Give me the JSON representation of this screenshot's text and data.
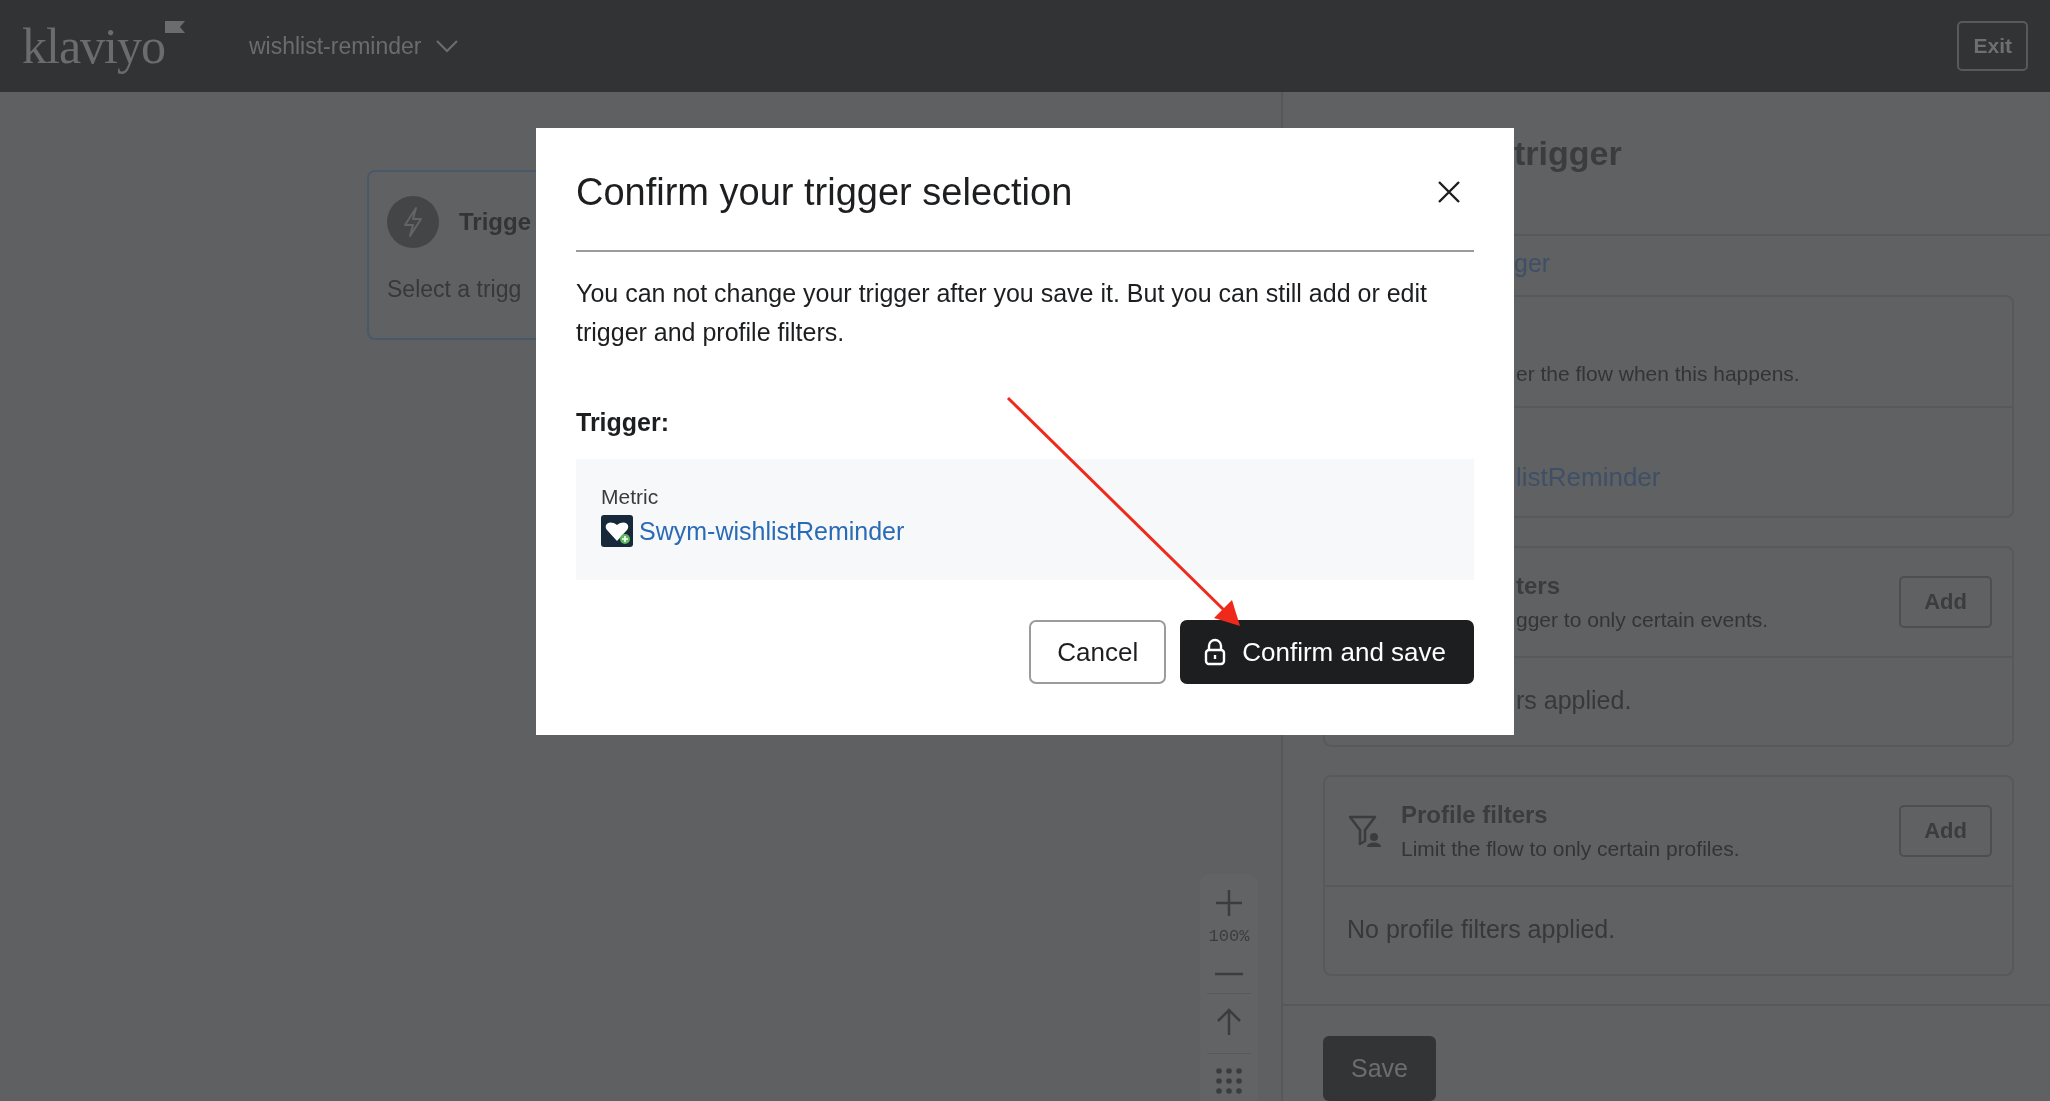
{
  "header": {
    "logo": "klaviyo",
    "flow_name": "wishlist-reminder",
    "exit_button": "Exit"
  },
  "canvas": {
    "trigger_card": {
      "title": "Trigge",
      "hint": "Select a trigg"
    },
    "zoom_label": "100%"
  },
  "side_panel": {
    "heading": "trigger",
    "link": "ger",
    "sections": [
      {
        "kind": "trigger",
        "description": "er the flow when this happens.",
        "metric": "listReminder"
      },
      {
        "kind": "trigger_filters",
        "title": "ters",
        "description": "gger to only certain events.",
        "button": "Add",
        "empty_text": "rs applied."
      },
      {
        "kind": "profile_filters",
        "title": "Profile filters",
        "description": "Limit the flow to only certain profiles.",
        "button": "Add",
        "empty_text": "No profile filters applied."
      }
    ],
    "save_button": "Save"
  },
  "modal": {
    "title": "Confirm your trigger selection",
    "message": "You can not change your trigger after you save it. But you can still add or edit trigger and profile filters.",
    "trigger_label": "Trigger:",
    "metric_label": "Metric",
    "metric_name": "Swym-wishlistReminder",
    "buttons": [
      {
        "label": "Cancel",
        "kind": "secondary"
      },
      {
        "label": "Confirm and save",
        "kind": "primary"
      }
    ]
  }
}
